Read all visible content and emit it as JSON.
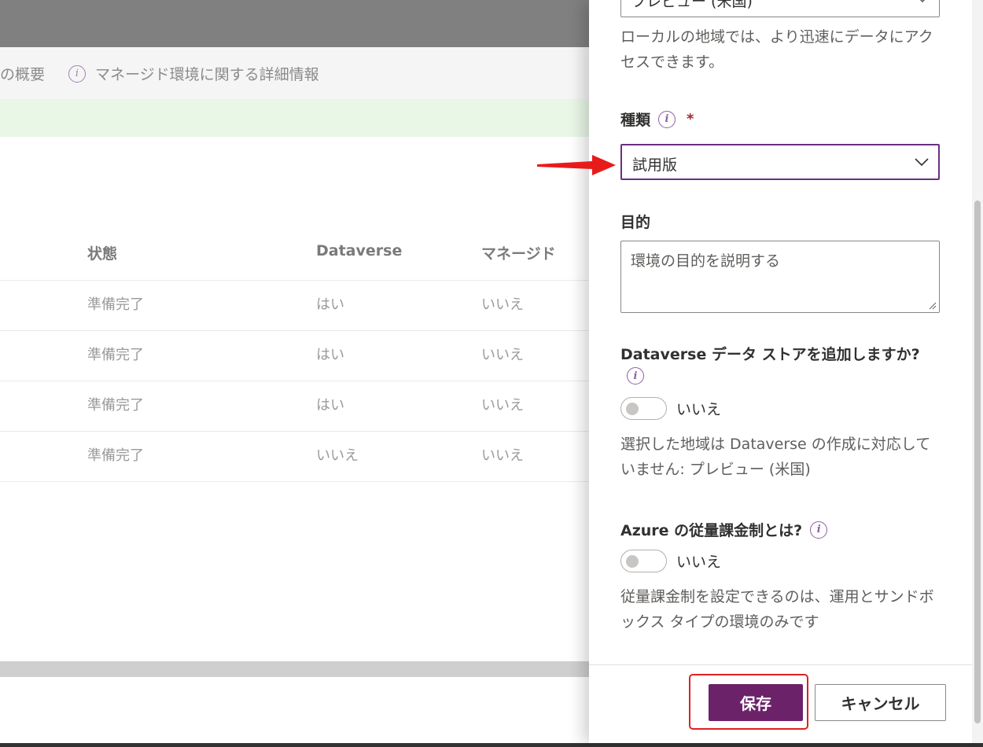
{
  "background": {
    "command_bar": {
      "overview_label": "の概要",
      "managed_info_label": "マネージド環境に関する詳細情報"
    },
    "table": {
      "columns": [
        "状態",
        "Dataverse",
        "マネージド"
      ],
      "rows": [
        [
          "準備完了",
          "はい",
          "いいえ"
        ],
        [
          "準備完了",
          "はい",
          "いいえ"
        ],
        [
          "準備完了",
          "はい",
          "いいえ"
        ],
        [
          "準備完了",
          "いいえ",
          "いいえ"
        ]
      ]
    }
  },
  "panel": {
    "region": {
      "selected_value": "プレビュー (米国)",
      "help_text": "ローカルの地域では、より迅速にデータにアクセスできます。"
    },
    "type": {
      "label": "種類",
      "required_mark": "*",
      "selected_value": "試用版"
    },
    "purpose": {
      "label": "目的",
      "placeholder": "環境の目的を説明する"
    },
    "dataverse": {
      "label": "Dataverse データ ストアを追加しますか?",
      "toggle_label": "いいえ",
      "toggle_on": false,
      "help_text": "選択した地域は Dataverse の作成に対応していません: プレビュー (米国)"
    },
    "azure_billing": {
      "label": "Azure の従量課金制とは?",
      "toggle_label": "いいえ",
      "toggle_on": false,
      "help_text": "従量課金制を設定できるのは、運用とサンドボックス タイプの環境のみです"
    },
    "footer": {
      "save_label": "保存",
      "cancel_label": "キャンセル"
    }
  },
  "colors": {
    "accent": "#6b2269",
    "annotation_red": "#e02020",
    "focus_border": "#6b2f80"
  }
}
